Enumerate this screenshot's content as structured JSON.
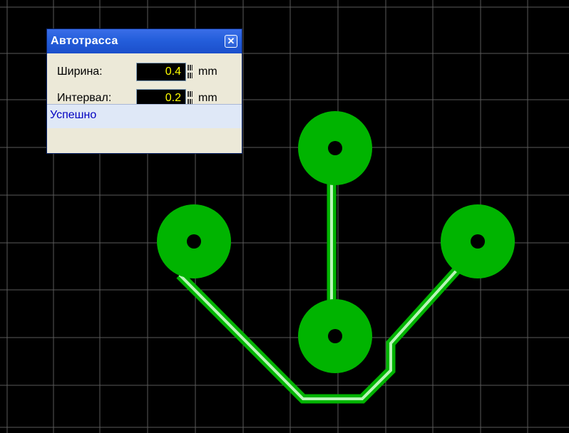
{
  "panel": {
    "title": "Автотрасса",
    "close_glyph": "✕",
    "width_label": "Ширина:",
    "width_value": "0.4",
    "width_unit": "mm",
    "interval_label": "Интервал:",
    "interval_value": "0.2",
    "interval_unit": "mm",
    "status": "Успешно"
  },
  "colors": {
    "background": "#000000",
    "grid": "#5a5a5a",
    "copper": "#00b400",
    "trace_highlight": "#b8f5b8",
    "pad_hole": "#000000"
  },
  "icons": [
    "close-icon",
    "spin-icon"
  ]
}
